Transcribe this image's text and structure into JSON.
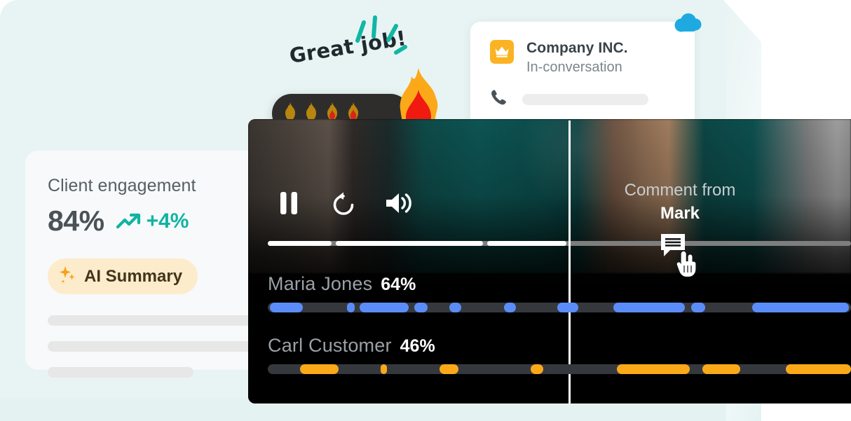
{
  "theme": {
    "background": "#e8f4f3",
    "card_background": "#f7f9fa",
    "accent_teal": "#10b3a3",
    "accent_orange": "#fba919",
    "accent_blue": "#5b8dfa",
    "badge_background": "#fdeccb",
    "video_background": "#000000"
  },
  "engagement_card": {
    "title": "Client engagement",
    "value": "84%",
    "delta": "+4%",
    "delta_icon": "trend-up-icon",
    "ai_badge": {
      "label": "AI Summary",
      "icon": "sparkles-icon"
    },
    "placeholder_rows": 3
  },
  "company_card": {
    "icon": "crown-icon",
    "name": "Company INC.",
    "status": "In-conversation",
    "phone_icon": "phone-icon",
    "cloud_icon": "cloud-icon"
  },
  "praise": {
    "text": "Great job!",
    "sparkle_icon": "sparkle-burst-icon",
    "streak": {
      "small_flames": 4,
      "big_flame_icon": "flame-icon"
    }
  },
  "video_player": {
    "controls": [
      {
        "name": "pause-button",
        "icon": "pause-icon"
      },
      {
        "name": "replay-button",
        "icon": "replay-icon"
      },
      {
        "name": "volume-button",
        "icon": "volume-icon"
      }
    ],
    "progress": {
      "segments": [
        {
          "start": 0,
          "width": 10.9
        },
        {
          "start": 11.6,
          "width": 25.3
        },
        {
          "start": 37.6,
          "width": 62.4
        }
      ],
      "playhead_percent": 51.6,
      "track_color": "#7e7e7e",
      "played_color": "#ffffff"
    },
    "comment": {
      "from_label": "Comment from",
      "author": "Mark",
      "marker_icon": "comment-icon",
      "cursor_icon": "pointing-hand-cursor-icon"
    }
  },
  "speakers": [
    {
      "name": "Maria Jones",
      "percent": "64%",
      "color": "#5b8dfa",
      "segments": [
        {
          "start": 0.4,
          "width": 5.6
        },
        {
          "start": 13.6,
          "width": 1.3
        },
        {
          "start": 15.8,
          "width": 8.4
        },
        {
          "start": 25.1,
          "width": 2.3
        },
        {
          "start": 31.1,
          "width": 2.1
        },
        {
          "start": 40.5,
          "width": 2.1
        },
        {
          "start": 49.6,
          "width": 3.6
        },
        {
          "start": 59.2,
          "width": 12.3
        },
        {
          "start": 72.6,
          "width": 2.4
        },
        {
          "start": 83.0,
          "width": 16.6
        }
      ]
    },
    {
      "name": "Carl Customer",
      "percent": "46%",
      "color": "#fba919",
      "segments": [
        {
          "start": 5.5,
          "width": 6.6
        },
        {
          "start": 19.4,
          "width": 1.0
        },
        {
          "start": 29.5,
          "width": 3.2
        },
        {
          "start": 45.1,
          "width": 2.1
        },
        {
          "start": 59.8,
          "width": 12.5
        },
        {
          "start": 74.5,
          "width": 6.5
        },
        {
          "start": 88.8,
          "width": 11.2
        }
      ]
    }
  ]
}
